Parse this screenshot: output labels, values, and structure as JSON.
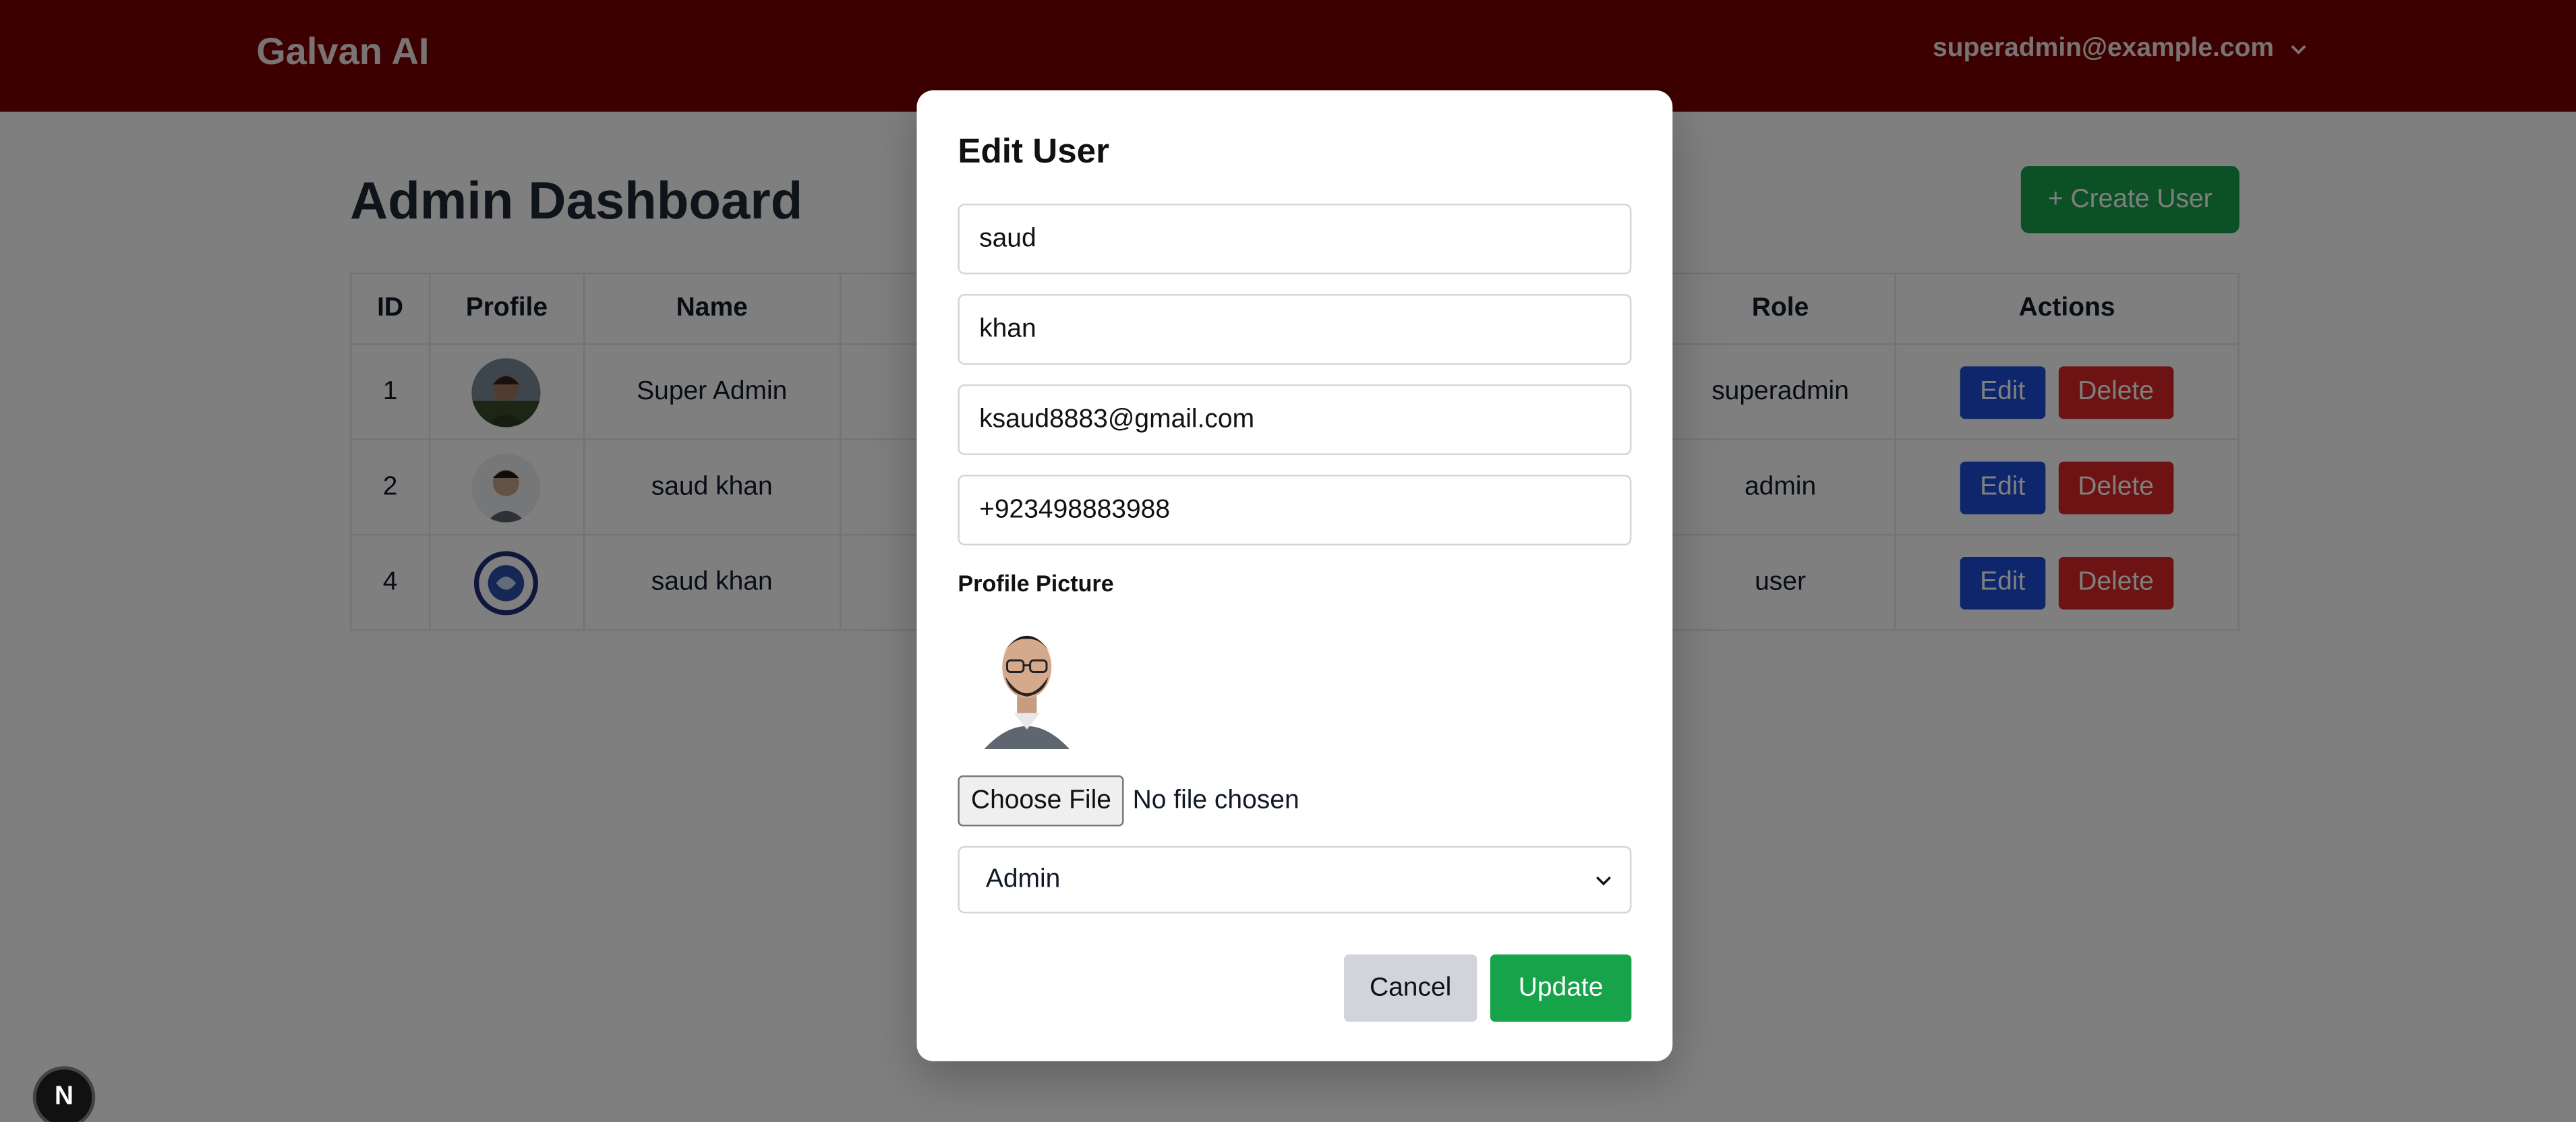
{
  "header": {
    "brand": "Galvan AI",
    "user_email": "superadmin@example.com"
  },
  "dashboard": {
    "title": "Admin Dashboard",
    "create_button": "+ Create User",
    "columns": [
      "ID",
      "Profile",
      "Name",
      "Role",
      "Actions"
    ],
    "rows": [
      {
        "id": "1",
        "name": "Super Admin",
        "role": "superadmin"
      },
      {
        "id": "2",
        "name": "saud khan",
        "role": "admin"
      },
      {
        "id": "4",
        "name": "saud khan",
        "role": "user"
      }
    ],
    "edit_label": "Edit",
    "delete_label": "Delete"
  },
  "modal": {
    "title": "Edit User",
    "first_name": "saud",
    "last_name": "khan",
    "email": "ksaud8883@gmail.com",
    "phone": "+923498883988",
    "profile_label": "Profile Picture",
    "file_button": "Choose File",
    "file_status": "No file chosen",
    "role_selected": "Admin",
    "cancel_label": "Cancel",
    "update_label": "Update"
  },
  "badge": {
    "letter": "N"
  },
  "colors": {
    "header": "#7a0000",
    "primary_green": "#16a34a",
    "edit_blue": "#1d4ed8",
    "delete_red": "#dc2626"
  }
}
